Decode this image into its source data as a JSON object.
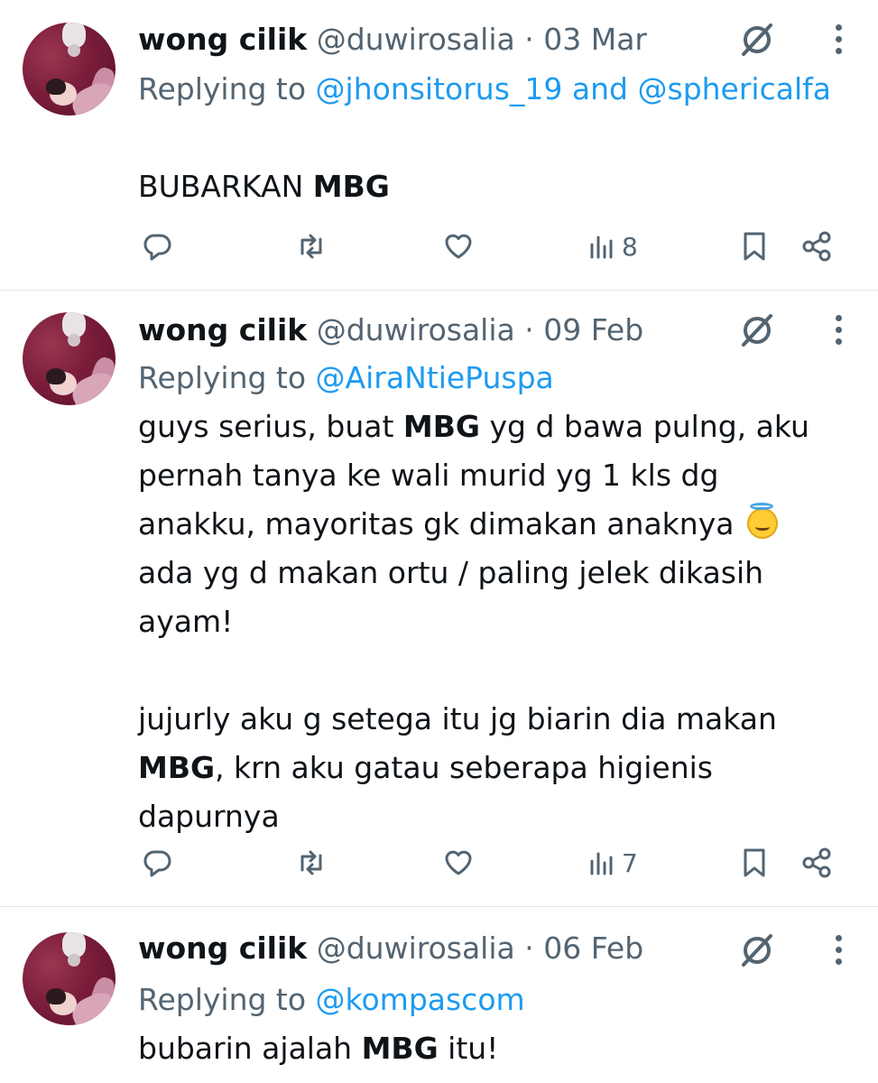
{
  "tweets": [
    {
      "name": "wong cilik",
      "handle": "@duwirosalia",
      "separator": "·",
      "date": "03 Mar",
      "replying_prefix": "Replying to",
      "mentions_line": [
        "@jhonsitorus_19",
        "and",
        "@sphericalfa"
      ],
      "body": {
        "t1": "BUBARKAN ",
        "b1": "MBG"
      },
      "views": "8"
    },
    {
      "name": "wong cilik",
      "handle": "@duwirosalia",
      "separator": "·",
      "date": "09 Feb",
      "replying_prefix": "Replying to",
      "mention": "@AiraNtiePuspa",
      "body": {
        "p1_a": "guys serius, buat ",
        "p1_b": "MBG",
        "p1_c": " yg d bawa pulng, aku pernah tanya ke wali murid yg 1 kls dg anakku, mayoritas gk dimakan anaknya",
        "p1_d": " ada yg d makan ortu / paling jelek dikasih ayam!",
        "p2_a": "jujurly aku g setega itu jg biarin dia makan ",
        "p2_b": "MBG",
        "p2_c": ", krn aku gatau seberapa higienis dapurnya"
      },
      "emoji": "smiling-face-with-halo",
      "views": "7"
    },
    {
      "name": "wong cilik",
      "handle": "@duwirosalia",
      "separator": "·",
      "date": "06 Feb",
      "replying_prefix": "Replying to",
      "mention": "@kompascom",
      "body": {
        "t1": "bubarin ajalah ",
        "b1": "MBG",
        "t2": " itu!"
      }
    }
  ],
  "colors": {
    "text": "#0f1419",
    "secondary": "#536471",
    "link": "#1d9bf0",
    "divider": "#e1e6ea"
  }
}
